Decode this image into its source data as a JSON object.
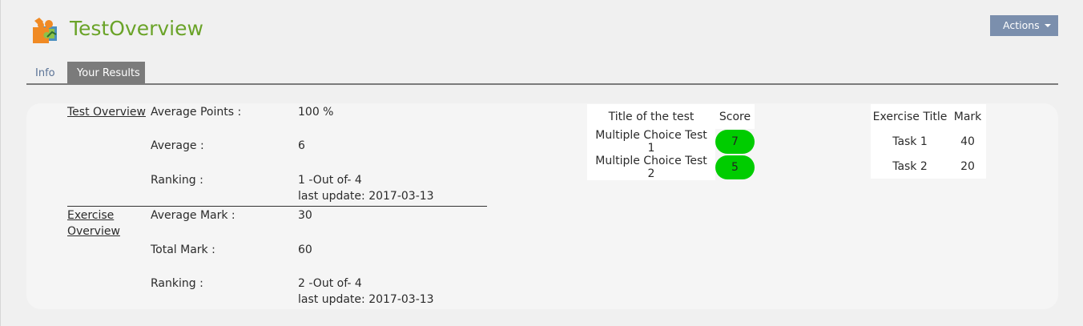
{
  "header": {
    "title": "TestOverview",
    "actions_label": "Actions",
    "logo_icon": "puzzle-icon",
    "title_color": "#6aa328"
  },
  "tabs": [
    {
      "label": "Info",
      "active": false
    },
    {
      "label": "Your Results",
      "active": true
    }
  ],
  "test_overview": {
    "link": "Test Overview",
    "rows": [
      {
        "label": "Average Points :",
        "value": "100 %"
      },
      {
        "label": "Average :",
        "value": "6"
      },
      {
        "label": "Ranking :",
        "value": "1 -Out of- 4",
        "update": "last update: 2017-03-13"
      }
    ]
  },
  "exercise_overview": {
    "link_line1": "Exercise",
    "link_line2": "Overview",
    "rows": [
      {
        "label": "Average Mark :",
        "value": "30"
      },
      {
        "label": "Total Mark :",
        "value": "60"
      },
      {
        "label": "Ranking :",
        "value": "2 -Out of- 4",
        "update": "last update: 2017-03-13"
      }
    ]
  },
  "tests_table": {
    "headers": [
      "Title of the test",
      "Score"
    ],
    "rows": [
      {
        "title": "Multiple Choice Test 1",
        "score": "7"
      },
      {
        "title": "Multiple Choice Test 2",
        "score": "5"
      }
    ],
    "score_color": "#00cc00"
  },
  "exercise_table": {
    "headers": [
      "Exercise Title",
      "Mark"
    ],
    "rows": [
      {
        "title": "Task 1",
        "mark": "40"
      },
      {
        "title": "Task 2",
        "mark": "20"
      }
    ]
  }
}
